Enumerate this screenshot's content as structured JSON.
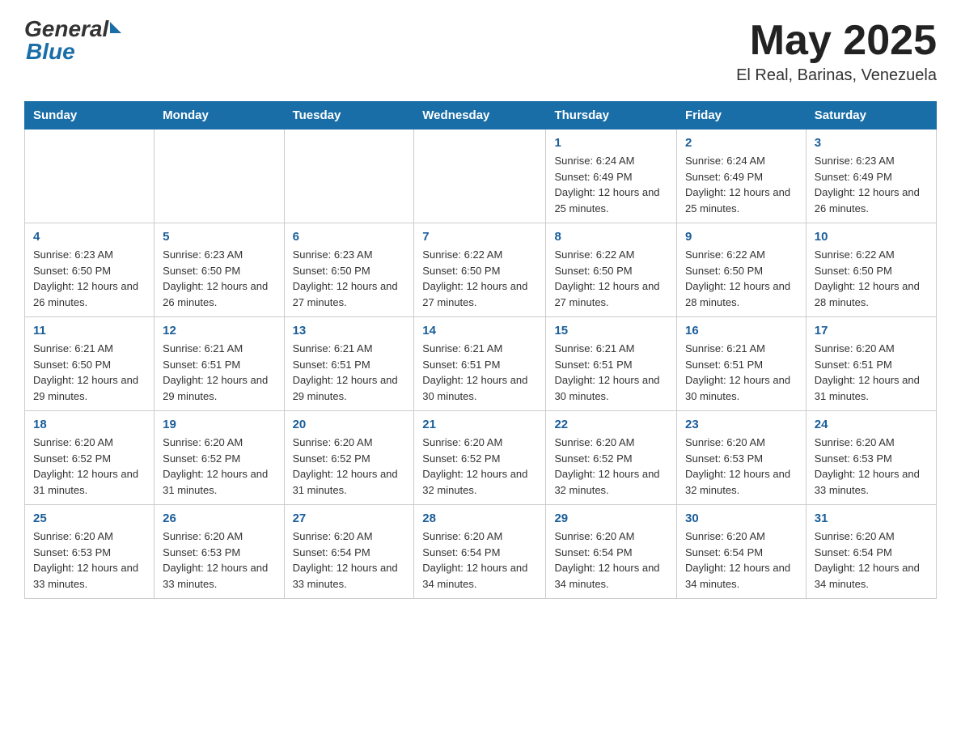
{
  "header": {
    "logo": {
      "general": "General",
      "blue": "Blue"
    },
    "title": "May 2025",
    "location": "El Real, Barinas, Venezuela"
  },
  "weekdays": [
    "Sunday",
    "Monday",
    "Tuesday",
    "Wednesday",
    "Thursday",
    "Friday",
    "Saturday"
  ],
  "weeks": [
    [
      {
        "day": "",
        "info": ""
      },
      {
        "day": "",
        "info": ""
      },
      {
        "day": "",
        "info": ""
      },
      {
        "day": "",
        "info": ""
      },
      {
        "day": "1",
        "info": "Sunrise: 6:24 AM\nSunset: 6:49 PM\nDaylight: 12 hours and 25 minutes."
      },
      {
        "day": "2",
        "info": "Sunrise: 6:24 AM\nSunset: 6:49 PM\nDaylight: 12 hours and 25 minutes."
      },
      {
        "day": "3",
        "info": "Sunrise: 6:23 AM\nSunset: 6:49 PM\nDaylight: 12 hours and 26 minutes."
      }
    ],
    [
      {
        "day": "4",
        "info": "Sunrise: 6:23 AM\nSunset: 6:50 PM\nDaylight: 12 hours and 26 minutes."
      },
      {
        "day": "5",
        "info": "Sunrise: 6:23 AM\nSunset: 6:50 PM\nDaylight: 12 hours and 26 minutes."
      },
      {
        "day": "6",
        "info": "Sunrise: 6:23 AM\nSunset: 6:50 PM\nDaylight: 12 hours and 27 minutes."
      },
      {
        "day": "7",
        "info": "Sunrise: 6:22 AM\nSunset: 6:50 PM\nDaylight: 12 hours and 27 minutes."
      },
      {
        "day": "8",
        "info": "Sunrise: 6:22 AM\nSunset: 6:50 PM\nDaylight: 12 hours and 27 minutes."
      },
      {
        "day": "9",
        "info": "Sunrise: 6:22 AM\nSunset: 6:50 PM\nDaylight: 12 hours and 28 minutes."
      },
      {
        "day": "10",
        "info": "Sunrise: 6:22 AM\nSunset: 6:50 PM\nDaylight: 12 hours and 28 minutes."
      }
    ],
    [
      {
        "day": "11",
        "info": "Sunrise: 6:21 AM\nSunset: 6:50 PM\nDaylight: 12 hours and 29 minutes."
      },
      {
        "day": "12",
        "info": "Sunrise: 6:21 AM\nSunset: 6:51 PM\nDaylight: 12 hours and 29 minutes."
      },
      {
        "day": "13",
        "info": "Sunrise: 6:21 AM\nSunset: 6:51 PM\nDaylight: 12 hours and 29 minutes."
      },
      {
        "day": "14",
        "info": "Sunrise: 6:21 AM\nSunset: 6:51 PM\nDaylight: 12 hours and 30 minutes."
      },
      {
        "day": "15",
        "info": "Sunrise: 6:21 AM\nSunset: 6:51 PM\nDaylight: 12 hours and 30 minutes."
      },
      {
        "day": "16",
        "info": "Sunrise: 6:21 AM\nSunset: 6:51 PM\nDaylight: 12 hours and 30 minutes."
      },
      {
        "day": "17",
        "info": "Sunrise: 6:20 AM\nSunset: 6:51 PM\nDaylight: 12 hours and 31 minutes."
      }
    ],
    [
      {
        "day": "18",
        "info": "Sunrise: 6:20 AM\nSunset: 6:52 PM\nDaylight: 12 hours and 31 minutes."
      },
      {
        "day": "19",
        "info": "Sunrise: 6:20 AM\nSunset: 6:52 PM\nDaylight: 12 hours and 31 minutes."
      },
      {
        "day": "20",
        "info": "Sunrise: 6:20 AM\nSunset: 6:52 PM\nDaylight: 12 hours and 31 minutes."
      },
      {
        "day": "21",
        "info": "Sunrise: 6:20 AM\nSunset: 6:52 PM\nDaylight: 12 hours and 32 minutes."
      },
      {
        "day": "22",
        "info": "Sunrise: 6:20 AM\nSunset: 6:52 PM\nDaylight: 12 hours and 32 minutes."
      },
      {
        "day": "23",
        "info": "Sunrise: 6:20 AM\nSunset: 6:53 PM\nDaylight: 12 hours and 32 minutes."
      },
      {
        "day": "24",
        "info": "Sunrise: 6:20 AM\nSunset: 6:53 PM\nDaylight: 12 hours and 33 minutes."
      }
    ],
    [
      {
        "day": "25",
        "info": "Sunrise: 6:20 AM\nSunset: 6:53 PM\nDaylight: 12 hours and 33 minutes."
      },
      {
        "day": "26",
        "info": "Sunrise: 6:20 AM\nSunset: 6:53 PM\nDaylight: 12 hours and 33 minutes."
      },
      {
        "day": "27",
        "info": "Sunrise: 6:20 AM\nSunset: 6:54 PM\nDaylight: 12 hours and 33 minutes."
      },
      {
        "day": "28",
        "info": "Sunrise: 6:20 AM\nSunset: 6:54 PM\nDaylight: 12 hours and 34 minutes."
      },
      {
        "day": "29",
        "info": "Sunrise: 6:20 AM\nSunset: 6:54 PM\nDaylight: 12 hours and 34 minutes."
      },
      {
        "day": "30",
        "info": "Sunrise: 6:20 AM\nSunset: 6:54 PM\nDaylight: 12 hours and 34 minutes."
      },
      {
        "day": "31",
        "info": "Sunrise: 6:20 AM\nSunset: 6:54 PM\nDaylight: 12 hours and 34 minutes."
      }
    ]
  ]
}
